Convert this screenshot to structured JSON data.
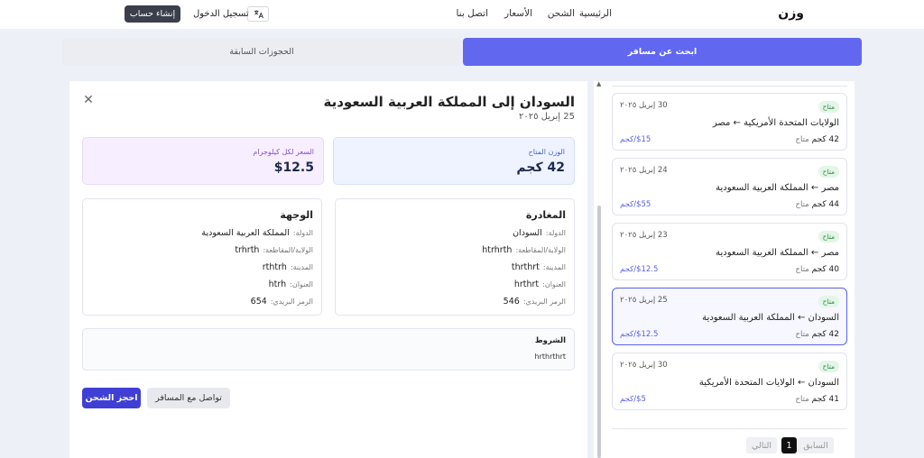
{
  "nav": {
    "logo": "وزن",
    "home": "الرئيسية",
    "shipping": "الشحن",
    "prices": "الأسعار",
    "contact": "اتصل بنا",
    "login": "تسجيل الدخول",
    "signup": "إنشاء حساب",
    "language_icon": "translate-icon"
  },
  "tabs": {
    "search_traveler": "ابحث عن مسافر",
    "previous_bookings": "الحجوزات السابقة"
  },
  "trips": [
    {
      "badge": "متاح",
      "date": "30 إبريل ٢٠٢٥",
      "route": "الولايات المتحدة الأمريكية ← مصر",
      "weight": "42",
      "weight_unit": "كجم",
      "weight_status": "متاح",
      "price": "$15/كجم",
      "selected": false
    },
    {
      "badge": "متاح",
      "date": "24 إبريل ٢٠٢٥",
      "route": "مصر ← المملكة العربية السعودية",
      "weight": "44",
      "weight_unit": "كجم",
      "weight_status": "متاح",
      "price": "$55/كجم",
      "selected": false
    },
    {
      "badge": "متاح",
      "date": "23 إبريل ٢٠٢٥",
      "route": "مصر ← المملكة العربية السعودية",
      "weight": "40",
      "weight_unit": "كجم",
      "weight_status": "متاح",
      "price": "$12.5/كجم",
      "selected": false
    },
    {
      "badge": "متاح",
      "date": "25 إبريل ٢٠٢٥",
      "route": "السودان ← المملكة العربية السعودية",
      "weight": "42",
      "weight_unit": "كجم",
      "weight_status": "متاح",
      "price": "$12.5/كجم",
      "selected": true
    },
    {
      "badge": "متاح",
      "date": "30 إبريل ٢٠٢٥",
      "route": "السودان ← الولايات المتحدة الأمريكية",
      "weight": "41",
      "weight_unit": "كجم",
      "weight_status": "متاح",
      "price": "$5/كجم",
      "selected": false
    }
  ],
  "pagination": {
    "prev": "السابق",
    "current": "1",
    "next": "التالي"
  },
  "detail": {
    "title": "السودان إلى المملكة العربية السعودية",
    "date": "25 إبريل ٢٠٢٥",
    "available_weight_label": "الوزن المتاح",
    "available_weight_value": "42 كجم",
    "price_per_kg_label": "السعر لكل كيلوجرام",
    "price_per_kg_value": "$12.5",
    "departure": {
      "title": "المغادرة",
      "country_label": "الدولة:",
      "country": "السودان",
      "state_label": "الولاية/المقاطعة:",
      "state": "htrhrth",
      "city_label": "المدينة:",
      "city": "thrthrt",
      "address_label": "العنوان:",
      "address": "hrthrt",
      "postal_label": "الرمز البريدي:",
      "postal": "546"
    },
    "destination": {
      "title": "الوجهة",
      "country_label": "الدولة:",
      "country": "المملكة العربية السعودية",
      "state_label": "الولاية/المقاطعة:",
      "state": "trhrth",
      "city_label": "المدينة:",
      "city": "rthtrh",
      "address_label": "العنوان:",
      "address": "htrh",
      "postal_label": "الرمز البريدي:",
      "postal": "654"
    },
    "terms_title": "الشروط",
    "terms_text": "hrthrthrt",
    "contact_button": "تواصل مع المسافر",
    "book_button": "احجز الشحن"
  },
  "colors": {
    "accent": "#6168ef",
    "primary_button": "#3f3fd6",
    "available_badge": "#2d8a43"
  }
}
